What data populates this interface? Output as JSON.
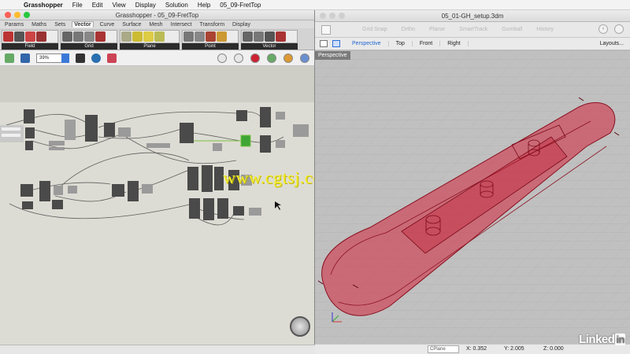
{
  "menubar": {
    "items": [
      "Grasshopper",
      "File",
      "Edit",
      "View",
      "Display",
      "Solution",
      "Help",
      "05_09-FretTop"
    ]
  },
  "grasshopper": {
    "title": "Grasshopper - 05_09-FretTop",
    "tabs": [
      "Params",
      "Maths",
      "Sets",
      "Vector",
      "Curve",
      "Surface",
      "Mesh",
      "Intersect",
      "Transform",
      "Display"
    ],
    "active_tab": "Vector",
    "ribbon_groups": [
      {
        "label": "Field",
        "icons": 4
      },
      {
        "label": "Grid",
        "icons": 4
      },
      {
        "label": "Plane",
        "icons": 4
      },
      {
        "label": "Point",
        "icons": 4
      },
      {
        "label": "Vector",
        "icons": 4
      }
    ],
    "zoom": "39%",
    "accent": "#3b79d8"
  },
  "watermark": "www.cgtsj.com",
  "rhino": {
    "title": "05_01-GH_setup.3dm",
    "toolbar": [
      "Grid Snap",
      "Ortho",
      "Planar",
      "SmartTrack",
      "Gumball",
      "History"
    ],
    "viewport_tabs": [
      "Perspective",
      "Top",
      "Front",
      "Right"
    ],
    "active_viewport_tab": "Perspective",
    "layouts_label": "Layouts...",
    "viewport_label": "Perspective",
    "status": {
      "cplane": "CPlane",
      "x": "X: 0.352",
      "y": "Y: 2.005",
      "z": "Z: 0.000"
    },
    "object_color": "#d2223a"
  },
  "brand": {
    "text": "Linked",
    "in": "in"
  }
}
